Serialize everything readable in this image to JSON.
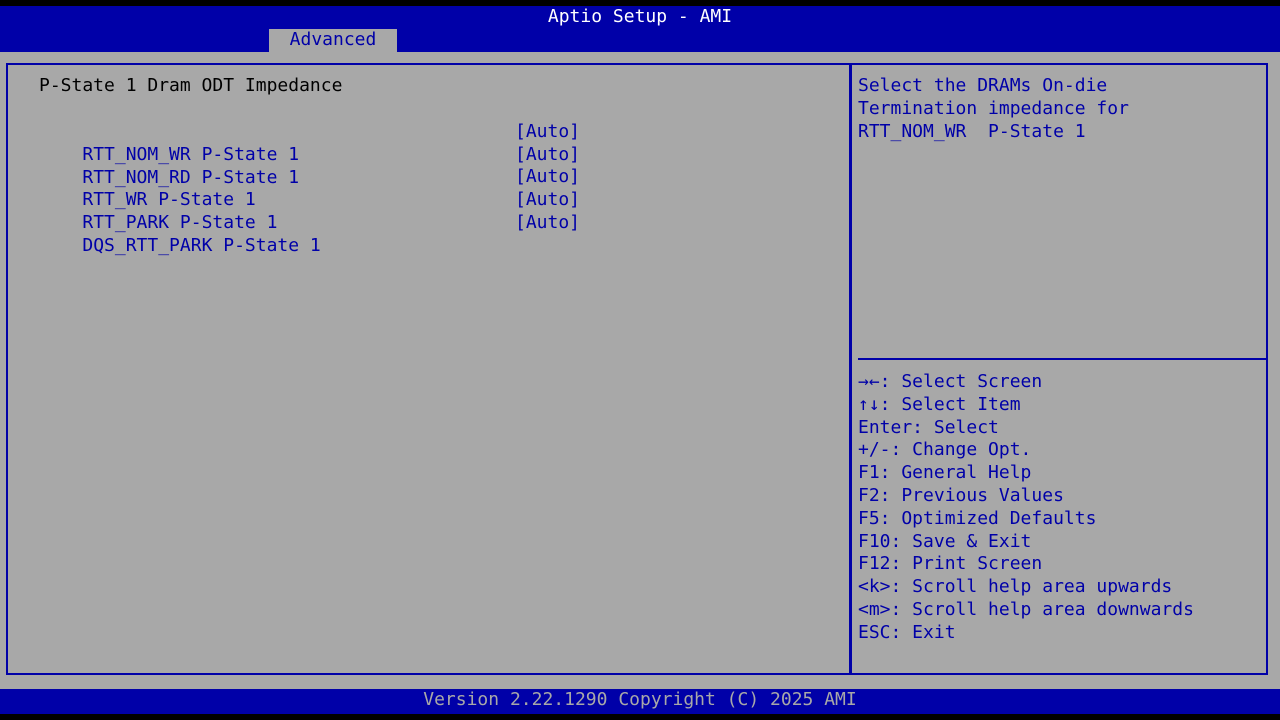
{
  "header": {
    "title": "Aptio Setup - AMI",
    "tab_label": "Advanced"
  },
  "main": {
    "page_title": "P-State 1 Dram ODT Impedance",
    "items": [
      {
        "label": "RTT_NOM_WR P-State 1",
        "value": "[Auto]"
      },
      {
        "label": "RTT_NOM_RD P-State 1",
        "value": "[Auto]"
      },
      {
        "label": "RTT_WR P-State 1",
        "value": "[Auto]"
      },
      {
        "label": "RTT_PARK P-State 1",
        "value": "[Auto]"
      },
      {
        "label": "DQS_RTT_PARK P-State 1",
        "value": "[Auto]"
      }
    ]
  },
  "help": {
    "lines": [
      "Select the DRAMs On-die",
      "Termination impedance for",
      "RTT_NOM_WR  P-State 1"
    ]
  },
  "keys": {
    "lines": [
      "→←: Select Screen",
      "↑↓: Select Item",
      "Enter: Select",
      "+/-: Change Opt.",
      "F1: General Help",
      "F2: Previous Values",
      "F5: Optimized Defaults",
      "F10: Save & Exit",
      "F12: Print Screen",
      "<k>: Scroll help area upwards",
      "<m>: Scroll help area downwards",
      "ESC: Exit"
    ]
  },
  "footer": {
    "version": "Version 2.22.1290 Copyright (C) 2025 AMI"
  },
  "colors": {
    "blue": "#0000a8",
    "gray": "#a8a8a8",
    "white": "#ffffff",
    "black": "#000000"
  }
}
